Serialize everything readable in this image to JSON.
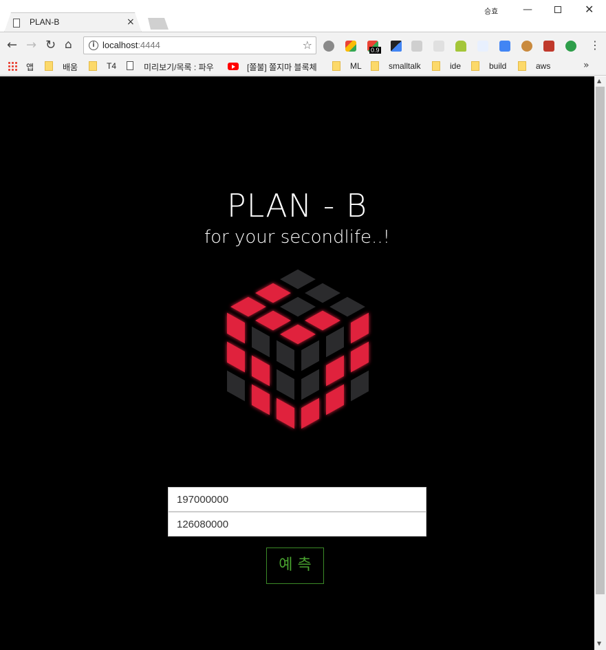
{
  "browser": {
    "tab_title": "PLAN-B",
    "tab_close": "×",
    "profile_name": "승효",
    "url_host": "localhost",
    "url_port": ":4444",
    "extension_badge": "0.9"
  },
  "bookmarks": [
    {
      "label": "앱"
    },
    {
      "label": "배움"
    },
    {
      "label": "T4"
    },
    {
      "label": "미리보기/목록 : 파우"
    },
    {
      "label": "[쫄불] 쫄지마 블록체"
    },
    {
      "label": "ML"
    },
    {
      "label": "smalltalk"
    },
    {
      "label": "ide"
    },
    {
      "label": "build"
    },
    {
      "label": "aws"
    }
  ],
  "hero": {
    "title": "PLAN - B",
    "subtitle": "for your secondlife..!"
  },
  "form": {
    "input1_value": "197000000",
    "input2_value": "126080000",
    "submit_label": "예 측"
  },
  "colors": {
    "background": "#000000",
    "cube_tile": "#2b2b2d",
    "cube_tile_lit": "#e0203c",
    "button_accent": "#49a32f"
  }
}
